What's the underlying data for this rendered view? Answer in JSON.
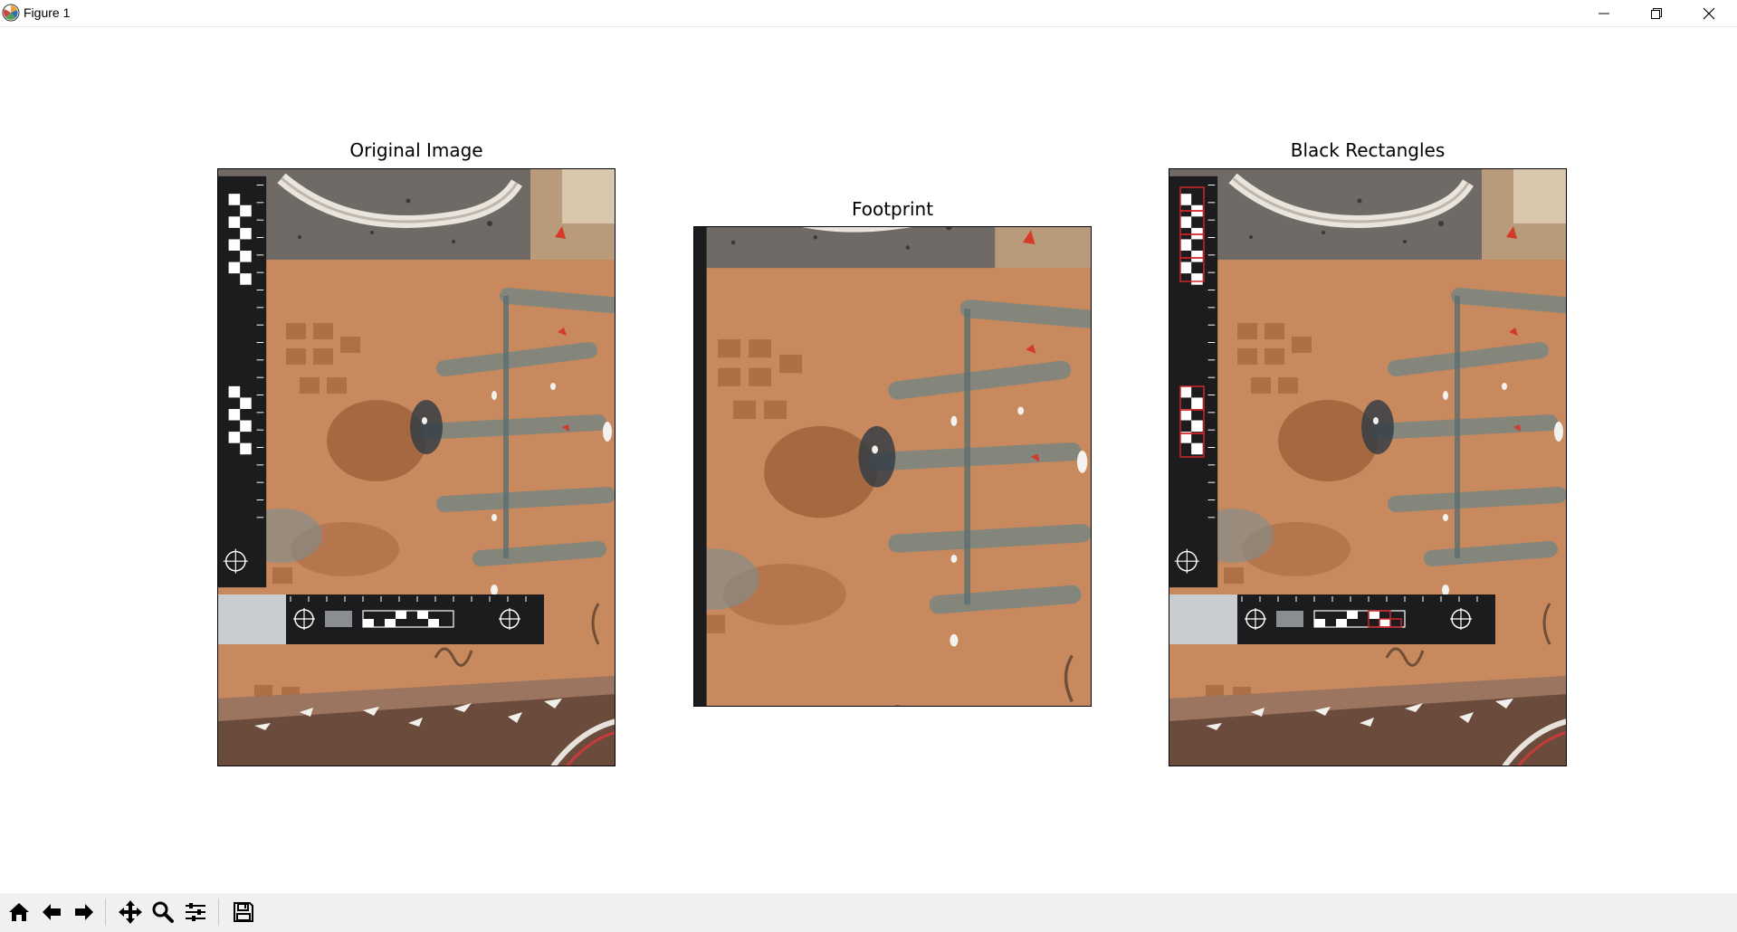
{
  "window": {
    "title": "Figure 1",
    "controls": [
      "minimize",
      "restore",
      "close"
    ]
  },
  "figure": {
    "axes": [
      {
        "title": "Original Image",
        "image": "photo of a shoe print on cardboard with L-shaped forensic scale"
      },
      {
        "title": "Footprint",
        "image": "cropped photo of the footprint region"
      },
      {
        "title": "Black Rectangles",
        "image": "photo with detected scale black rectangles outlined in red"
      }
    ]
  },
  "toolbar": {
    "buttons": [
      "home-icon",
      "back-icon",
      "forward-icon",
      "pan-icon",
      "zoom-icon",
      "configure-subplots-icon",
      "save-icon"
    ]
  },
  "colors": {
    "cardboard": "#c8895e",
    "floor": "#6f6a66",
    "scale": "#1c1c1e",
    "detection": "#d0252b",
    "toolbar_bg": "#f0f0f0"
  }
}
